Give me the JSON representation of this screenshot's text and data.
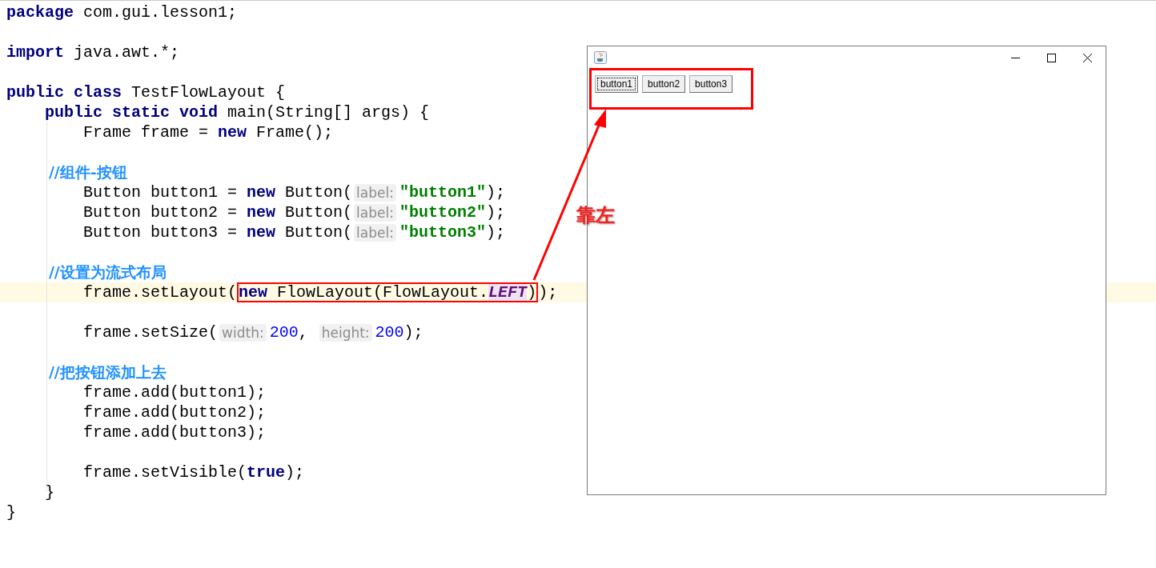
{
  "editor": {
    "lines": [
      {
        "highlighted": false,
        "tokens": [
          {
            "kind": "keyword",
            "text": "package"
          },
          {
            "kind": "plain",
            "text": " com.gui.lesson1;"
          }
        ]
      },
      {
        "highlighted": false
      },
      {
        "highlighted": false,
        "tokens": [
          {
            "kind": "keyword",
            "text": "import"
          },
          {
            "kind": "plain",
            "text": " java.awt.*;"
          }
        ]
      },
      {
        "highlighted": false
      },
      {
        "highlighted": false,
        "tokens": [
          {
            "kind": "keyword",
            "text": "public class"
          },
          {
            "kind": "plain",
            "text": " TestFlowLayout {"
          }
        ]
      },
      {
        "highlighted": false,
        "tokens": [
          {
            "kind": "keyword",
            "text": "    public static void"
          },
          {
            "kind": "plain",
            "text": " main(String[] args) {"
          }
        ]
      },
      {
        "highlighted": false,
        "tokens": [
          {
            "kind": "plain",
            "text": "        Frame frame = "
          },
          {
            "kind": "keyword",
            "text": "new"
          },
          {
            "kind": "plain",
            "text": " Frame();"
          }
        ]
      },
      {
        "highlighted": false
      },
      {
        "highlighted": false,
        "tokens": [
          {
            "kind": "comment",
            "text": "        //组件-按钮"
          }
        ]
      },
      {
        "highlighted": false,
        "tokens": [
          {
            "kind": "plain",
            "text": "        Button button1 = "
          },
          {
            "kind": "keyword",
            "text": "new"
          },
          {
            "kind": "plain",
            "text": " Button("
          },
          {
            "kind": "hint",
            "text": "label:"
          },
          {
            "kind": "string",
            "text": "\"button1\""
          },
          {
            "kind": "plain",
            "text": ");"
          }
        ]
      },
      {
        "highlighted": false,
        "tokens": [
          {
            "kind": "plain",
            "text": "        Button button2 = "
          },
          {
            "kind": "keyword",
            "text": "new"
          },
          {
            "kind": "plain",
            "text": " Button("
          },
          {
            "kind": "hint",
            "text": "label:"
          },
          {
            "kind": "string",
            "text": "\"button2\""
          },
          {
            "kind": "plain",
            "text": ");"
          }
        ]
      },
      {
        "highlighted": false,
        "tokens": [
          {
            "kind": "plain",
            "text": "        Button button3 = "
          },
          {
            "kind": "keyword",
            "text": "new"
          },
          {
            "kind": "plain",
            "text": " Button("
          },
          {
            "kind": "hint",
            "text": "label:"
          },
          {
            "kind": "string",
            "text": "\"button3\""
          },
          {
            "kind": "plain",
            "text": ");"
          }
        ]
      },
      {
        "highlighted": false
      },
      {
        "highlighted": false,
        "tokens": [
          {
            "kind": "comment",
            "text": "        //设置为流式布局"
          }
        ]
      },
      {
        "highlighted": true,
        "tokens": [
          {
            "kind": "plain",
            "text": "        frame.setLayout("
          },
          {
            "kind": "boxed",
            "tokens": [
              {
                "kind": "keyword",
                "text": "new"
              },
              {
                "kind": "plain",
                "text": " FlowLayout(FlowLayout."
              },
              {
                "kind": "constant",
                "text": "LEFT"
              },
              {
                "kind": "plain",
                "text": ")"
              }
            ]
          },
          {
            "kind": "plain",
            "text": ");"
          }
        ]
      },
      {
        "highlighted": false
      },
      {
        "highlighted": false,
        "tokens": [
          {
            "kind": "plain",
            "text": "        frame.setSize("
          },
          {
            "kind": "hint",
            "text": "width:"
          },
          {
            "kind": "number",
            "text": "200"
          },
          {
            "kind": "plain",
            "text": ", "
          },
          {
            "kind": "hint",
            "text": "height:"
          },
          {
            "kind": "number",
            "text": "200"
          },
          {
            "kind": "plain",
            "text": ");"
          }
        ]
      },
      {
        "highlighted": false
      },
      {
        "highlighted": false,
        "tokens": [
          {
            "kind": "comment",
            "text": "        //把按钮添加上去"
          }
        ]
      },
      {
        "highlighted": false,
        "tokens": [
          {
            "kind": "plain",
            "text": "        frame.add(button1);"
          }
        ]
      },
      {
        "highlighted": false,
        "tokens": [
          {
            "kind": "plain",
            "text": "        frame.add(button2);"
          }
        ]
      },
      {
        "highlighted": false,
        "tokens": [
          {
            "kind": "plain",
            "text": "        frame.add(button3);"
          }
        ]
      },
      {
        "highlighted": false
      },
      {
        "highlighted": false,
        "tokens": [
          {
            "kind": "plain",
            "text": "        frame.setVisible("
          },
          {
            "kind": "keyword",
            "text": "true"
          },
          {
            "kind": "plain",
            "text": ");"
          }
        ]
      },
      {
        "highlighted": false,
        "tokens": [
          {
            "kind": "plain",
            "text": "    }"
          }
        ]
      },
      {
        "highlighted": false,
        "tokens": [
          {
            "kind": "plain",
            "text": "}"
          }
        ]
      }
    ]
  },
  "annotation": {
    "label": "靠左"
  },
  "window": {
    "buttons": [
      {
        "label": "button1",
        "focused": true
      },
      {
        "label": "button2",
        "focused": false
      },
      {
        "label": "button3",
        "focused": false
      }
    ]
  }
}
